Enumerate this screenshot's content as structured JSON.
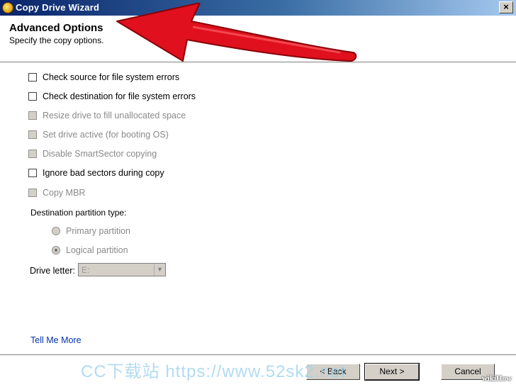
{
  "window": {
    "title": "Copy Drive Wizard",
    "close_glyph": "×"
  },
  "header": {
    "title": "Advanced Options",
    "subtitle": "Specify the copy options."
  },
  "options": [
    {
      "label": "Check source for file system errors",
      "checked": false,
      "enabled": true
    },
    {
      "label": "Check destination for file system errors",
      "checked": false,
      "enabled": true
    },
    {
      "label": "Resize drive to fill unallocated space",
      "checked": false,
      "enabled": false
    },
    {
      "label": "Set drive active (for booting OS)",
      "checked": false,
      "enabled": false
    },
    {
      "label": "Disable SmartSector copying",
      "checked": false,
      "enabled": false
    },
    {
      "label": "Ignore bad sectors during copy",
      "checked": false,
      "enabled": true
    },
    {
      "label": "Copy MBR",
      "checked": false,
      "enabled": false
    }
  ],
  "partition": {
    "label": "Destination partition type:",
    "primary_label": "Primary partition",
    "logical_label": "Logical partition",
    "selected": "logical"
  },
  "drive": {
    "label": "Drive letter:",
    "value": "E:",
    "arrow": "▼"
  },
  "links": {
    "tell_me_more": "Tell Me More"
  },
  "buttons": {
    "back": "< Back",
    "next": "Next >",
    "cancel": "Cancel"
  },
  "watermark": {
    "text": "CC下载站 https://www.52sk2.net",
    "brand": "wikiHow"
  },
  "icons": {
    "window": "wizard-app-icon",
    "close": "close-icon",
    "annotation": "red-arrow-icon",
    "dropdown": "chevron-down-icon"
  },
  "colors": {
    "titlebar_start": "#0a246a",
    "titlebar_end": "#a6caf0",
    "arrow": "#e0101e",
    "link": "#0033aa",
    "disabled_text": "#8a8a8a"
  }
}
